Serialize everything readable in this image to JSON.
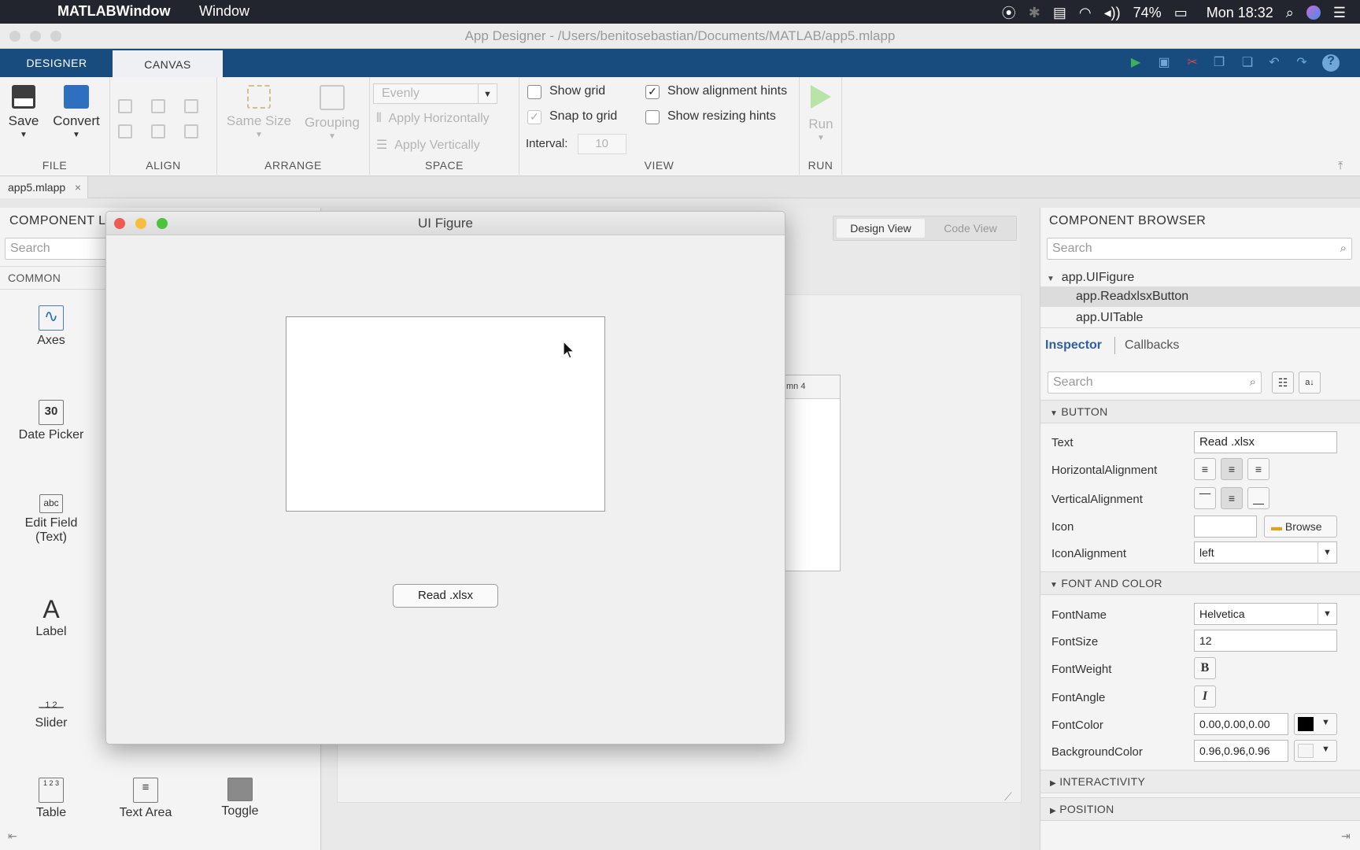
{
  "menubar": {
    "app_name": "MATLABWindow",
    "menu_window": "Window",
    "battery": "74%",
    "clock": "Mon 18:32",
    "icons": [
      "apple-icon",
      "record-icon",
      "bluetooth-icon",
      "keyboard-icon",
      "wifi-icon",
      "volume-icon",
      "battery-icon",
      "spotlight-icon",
      "siri-icon",
      "control-center-icon"
    ]
  },
  "titlebar": {
    "title": "App Designer - /Users/benitosebastian/Documents/MATLAB/app5.mlapp"
  },
  "tabs": {
    "designer": "DESIGNER",
    "canvas": "CANVAS"
  },
  "ribbon": {
    "file": {
      "save": "Save",
      "convert": "Convert",
      "label": "FILE"
    },
    "align": {
      "label": "ALIGN"
    },
    "arrange": {
      "same_size": "Same Size",
      "grouping": "Grouping",
      "label": "ARRANGE"
    },
    "space": {
      "evenly": "Evenly",
      "apply_h": "Apply Horizontally",
      "apply_v": "Apply Vertically",
      "label": "SPACE"
    },
    "view": {
      "show_grid": "Show grid",
      "snap_to_grid": "Snap to grid",
      "interval_label": "Interval:",
      "interval_value": "10",
      "show_alignment_hints": "Show alignment hints",
      "show_resizing_hints": "Show resizing hints",
      "label": "VIEW",
      "show_grid_checked": false,
      "snap_to_grid_checked": true,
      "show_alignment_hints_checked": true,
      "show_resizing_hints_checked": false
    },
    "run": {
      "run": "Run",
      "label": "RUN"
    }
  },
  "doc_tab": {
    "name": "app5.mlapp",
    "close": "×"
  },
  "component_library": {
    "title": "COMPONENT LI",
    "search_placeholder": "Search",
    "section": "COMMON",
    "items": [
      {
        "label": "Axes"
      },
      {
        "label": "Date Picker",
        "icon_text": "30"
      },
      {
        "label": "Edit Field\n(Text)",
        "icon_text": "abc"
      },
      {
        "label": "Label",
        "icon_text": "A"
      },
      {
        "label": "Slider",
        "ticks": "1  2"
      },
      {
        "label": "Table",
        "icon_text": "1 2 3"
      },
      {
        "label": "Text Area"
      },
      {
        "label": "Toggle"
      }
    ]
  },
  "center": {
    "design_view": "Design View",
    "code_view": "Code View",
    "column_header": "mn 4"
  },
  "ui_figure": {
    "title": "UI Figure",
    "button_text": "Read .xlsx"
  },
  "component_browser": {
    "title": "COMPONENT BROWSER",
    "search_placeholder": "Search",
    "tree": {
      "root": "app.UIFigure",
      "children": [
        "app.ReadxlsxButton",
        "app.UITable"
      ]
    }
  },
  "inspector": {
    "tab_inspector": "Inspector",
    "tab_callbacks": "Callbacks",
    "search_placeholder": "Search",
    "sections": {
      "button": "BUTTON",
      "font_and_color": "FONT AND COLOR",
      "interactivity": "INTERACTIVITY",
      "position": "POSITION"
    },
    "props": {
      "text_label": "Text",
      "text_value": "Read .xlsx",
      "halign_label": "HorizontalAlignment",
      "valign_label": "VerticalAlignment",
      "icon_label": "Icon",
      "browse": "Browse",
      "iconalign_label": "IconAlignment",
      "iconalign_value": "left",
      "fontname_label": "FontName",
      "fontname_value": "Helvetica",
      "fontsize_label": "FontSize",
      "fontsize_value": "12",
      "fontweight_label": "FontWeight",
      "fontangle_label": "FontAngle",
      "fontcolor_label": "FontColor",
      "fontcolor_value": "0.00,0.00,0.00",
      "bgcolor_label": "BackgroundColor",
      "bgcolor_value": "0.96,0.96,0.96"
    }
  },
  "colors": {
    "tab_bar": "#184b7e",
    "menubar": "#23252e",
    "close": "#ee5b53",
    "minimize": "#f6be3c",
    "zoom": "#4ec13f",
    "font_color_swatch": "#000000",
    "bg_color_swatch": "#f5f5f5"
  }
}
